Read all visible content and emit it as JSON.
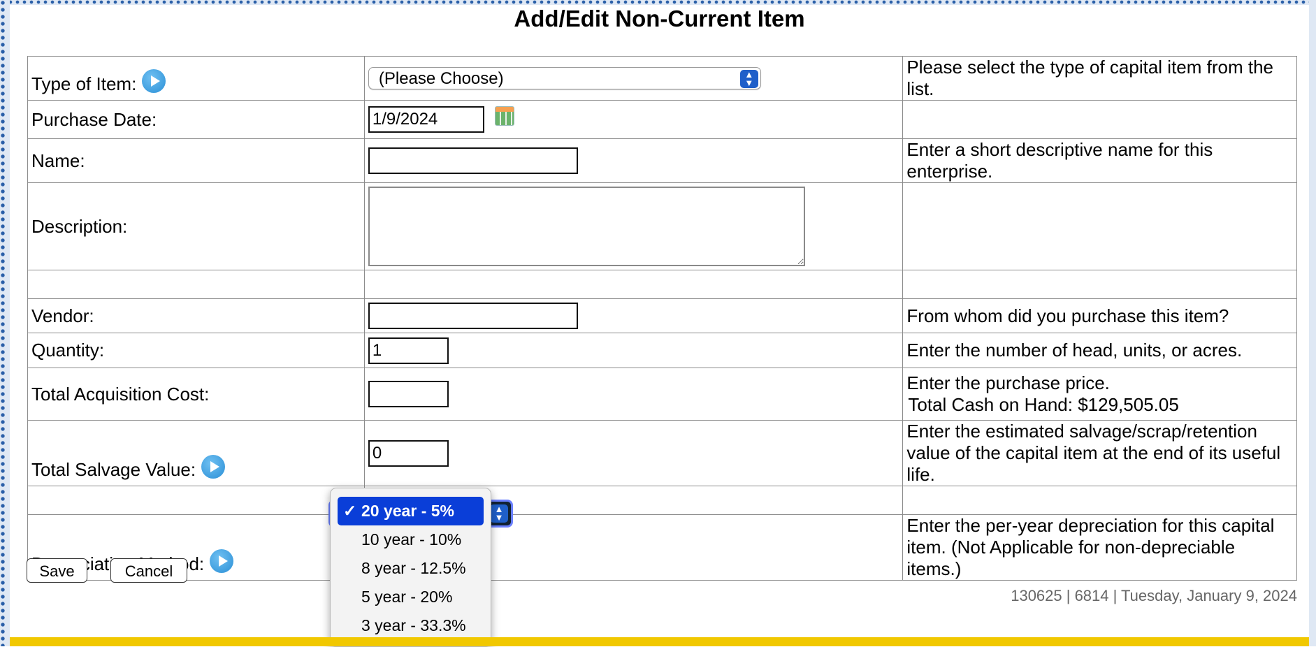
{
  "title": "Add/Edit Non-Current Item",
  "rows": {
    "type": {
      "label": "Type of Item:",
      "value": "(Please Choose)",
      "help": "Please select the type of capital item from the list."
    },
    "purchase_date": {
      "label": "Purchase Date:",
      "value": "1/9/2024",
      "help": ""
    },
    "name": {
      "label": "Name:",
      "value": "",
      "help": "Enter a short descriptive name for this enterprise."
    },
    "description": {
      "label": "Description:",
      "value": ""
    },
    "vendor": {
      "label": "Vendor:",
      "value": "",
      "help": "From whom did you purchase this item?"
    },
    "quantity": {
      "label": "Quantity:",
      "value": "1",
      "help": "Enter the number of head, units, or acres."
    },
    "acq_cost": {
      "label": "Total Acquisition Cost:",
      "value": "",
      "help": "Enter the purchase price.",
      "help2": "Total Cash on Hand: $129,505.05"
    },
    "salvage": {
      "label": "Total Salvage Value:",
      "value": "0",
      "help": "Enter the estimated salvage/scrap/retention value of the capital item at the end of its useful life."
    },
    "depreciation": {
      "label": "Depreciation Method:",
      "help": "Enter the per-year depreciation for this capital item. (Not Applicable for non-depreciable items.)"
    }
  },
  "dropdown": {
    "options": [
      "20 year - 5%",
      "10 year - 10%",
      "8 year - 12.5%",
      "5 year - 20%",
      "3 year - 33.3%"
    ],
    "selected": "20 year - 5%",
    "check": "✓"
  },
  "buttons": {
    "save": "Save",
    "cancel": "Cancel"
  },
  "footer": "130625 | 6814 | Tuesday, January 9, 2024",
  "colors": {
    "dropdown_selected": "#0a3ed8",
    "bottom_bar": "#f1c800",
    "help_icon": "#2a8fd6"
  },
  "icons": [
    "help-icon",
    "calendar-icon",
    "select-arrow-icon",
    "check-icon"
  ]
}
